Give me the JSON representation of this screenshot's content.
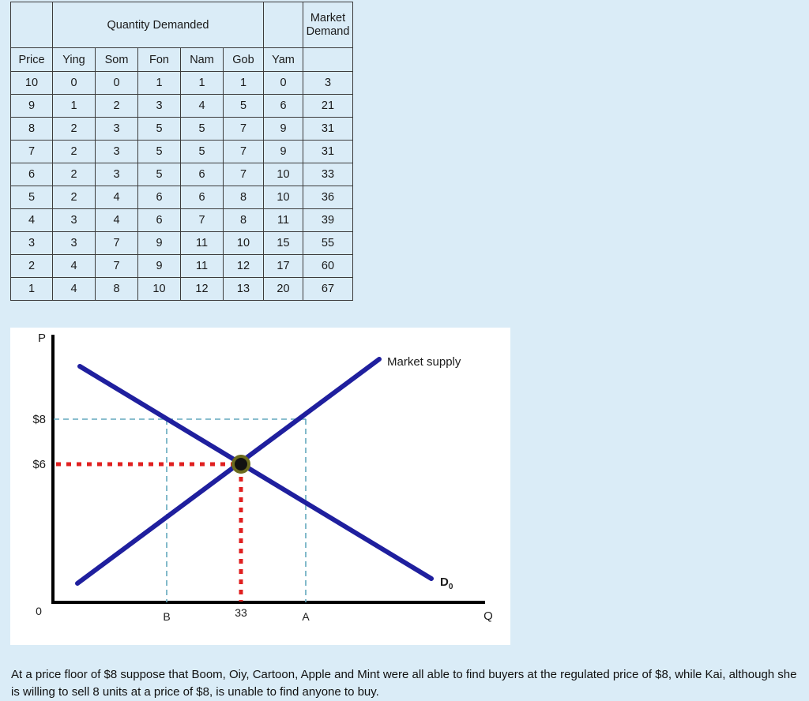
{
  "table": {
    "group_header": "Quantity Demanded",
    "market_demand_header": "Market Demand",
    "columns": [
      "Price",
      "Ying",
      "Som",
      "Fon",
      "Nam",
      "Gob",
      "Yam"
    ],
    "rows": [
      {
        "price": "10",
        "ying": "0",
        "som": "0",
        "fon": "1",
        "nam": "1",
        "gob": "1",
        "yam": "0",
        "market": "3"
      },
      {
        "price": "9",
        "ying": "1",
        "som": "2",
        "fon": "3",
        "nam": "4",
        "gob": "5",
        "yam": "6",
        "market": "21"
      },
      {
        "price": "8",
        "ying": "2",
        "som": "3",
        "fon": "5",
        "nam": "5",
        "gob": "7",
        "yam": "9",
        "market": "31"
      },
      {
        "price": "7",
        "ying": "2",
        "som": "3",
        "fon": "5",
        "nam": "5",
        "gob": "7",
        "yam": "9",
        "market": "31"
      },
      {
        "price": "6",
        "ying": "2",
        "som": "3",
        "fon": "5",
        "nam": "6",
        "gob": "7",
        "yam": "10",
        "market": "33"
      },
      {
        "price": "5",
        "ying": "2",
        "som": "4",
        "fon": "6",
        "nam": "6",
        "gob": "8",
        "yam": "10",
        "market": "36"
      },
      {
        "price": "4",
        "ying": "3",
        "som": "4",
        "fon": "6",
        "nam": "7",
        "gob": "8",
        "yam": "11",
        "market": "39"
      },
      {
        "price": "3",
        "ying": "3",
        "som": "7",
        "fon": "9",
        "nam": "11",
        "gob": "10",
        "yam": "15",
        "market": "55"
      },
      {
        "price": "2",
        "ying": "4",
        "som": "7",
        "fon": "9",
        "nam": "11",
        "gob": "12",
        "yam": "17",
        "market": "60"
      },
      {
        "price": "1",
        "ying": "4",
        "som": "8",
        "fon": "10",
        "nam": "12",
        "gob": "13",
        "yam": "20",
        "market": "67"
      }
    ]
  },
  "chart_data": {
    "type": "line",
    "title": "",
    "xlabel": "Q",
    "ylabel": "P",
    "origin_label": "0",
    "y_ticks": [
      "$8",
      "$6"
    ],
    "x_ticks": [
      "B",
      "33",
      "A"
    ],
    "series": [
      {
        "name": "Market  supply",
        "label": "Market  supply",
        "color": "#1f1f9e",
        "points": [
          [
            98,
            739
          ],
          [
            480,
            455
          ]
        ]
      },
      {
        "name": "D0",
        "label": "D",
        "sublabel": "0",
        "color": "#1f1f9e",
        "points": [
          [
            101,
            464
          ],
          [
            546,
            733
          ]
        ]
      }
    ],
    "equilibrium": {
      "price_label": "$6",
      "quantity_label": "33",
      "x": 305,
      "y": 588
    },
    "price_floor": {
      "label": "$8",
      "y": 531,
      "surplus_low_label": "B",
      "surplus_high_label": "A"
    },
    "guide_color": "#63a8bd",
    "floor_marker_color": "#e02020",
    "notes": "Demand and supply cross at P=$6, Q=33; price floor at $8 creates surplus from B to A"
  },
  "caption": {
    "text": "At a price floor of $8 suppose that Boom, Oiy, Cartoon, Apple and Mint were all able to find buyers at the regulated price of $8, while Kai, although she is willing to sell 8 units at a price of $8, is unable to find anyone to buy."
  }
}
